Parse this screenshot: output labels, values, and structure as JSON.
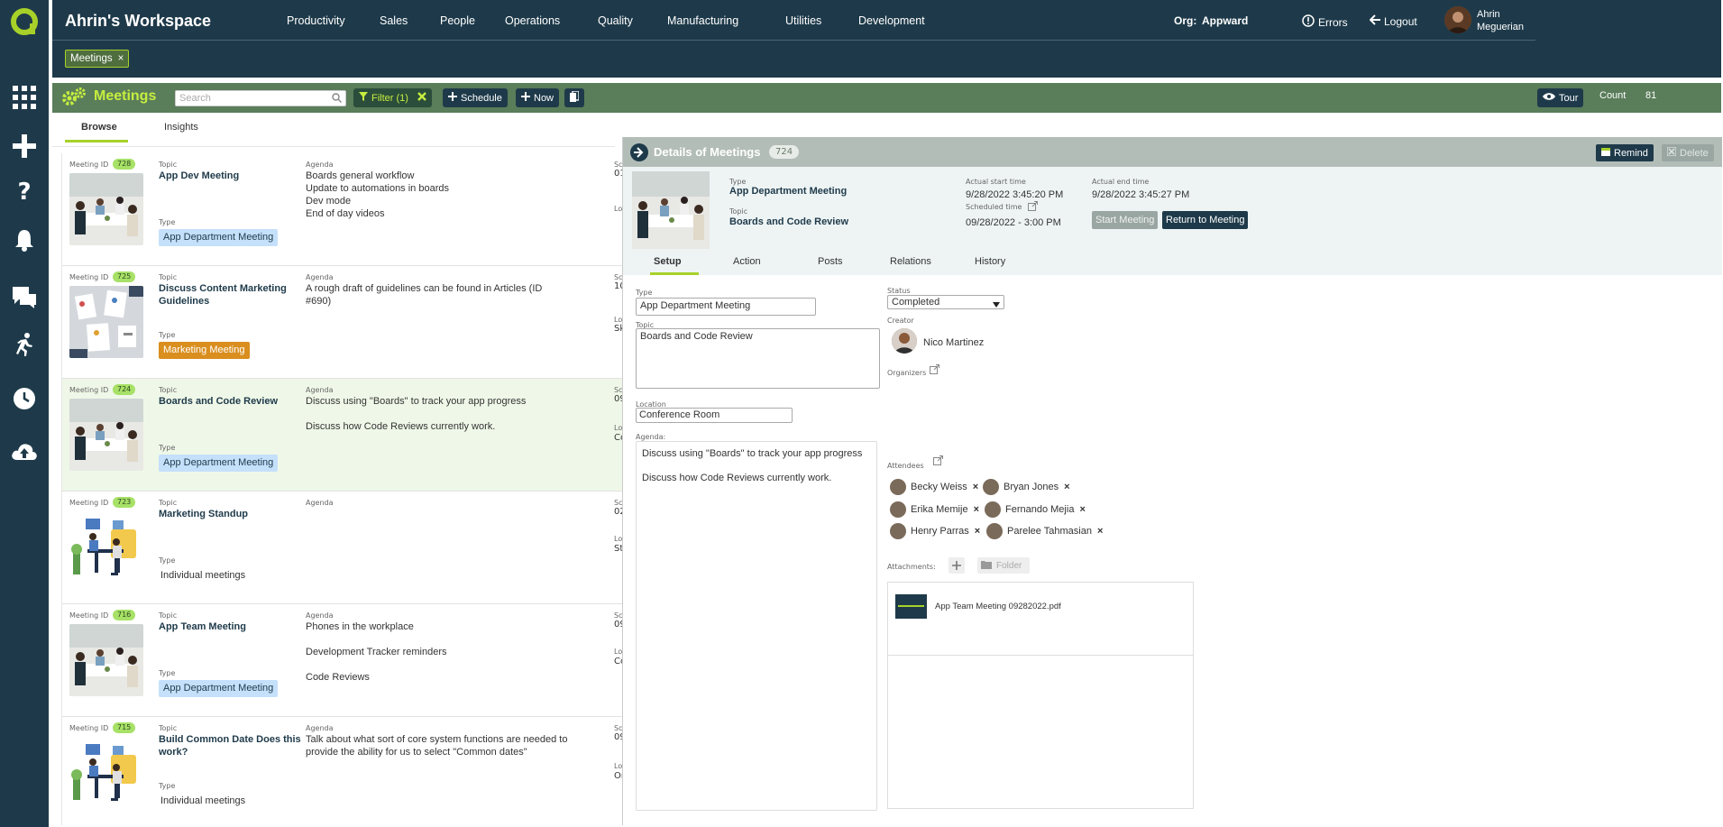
{
  "workspace": {
    "title": "Ahrin's Workspace"
  },
  "topnav": [
    "Productivity",
    "Sales",
    "People",
    "Operations",
    "Quality",
    "Manufacturing",
    "Utilities",
    "Development"
  ],
  "org": {
    "label": "Org:",
    "value": "Appward"
  },
  "header_actions": {
    "errors": "Errors",
    "logout": "Logout"
  },
  "user": {
    "first": "Ahrin",
    "last": "Meguerian"
  },
  "open_tab": {
    "label": "Meetings",
    "close": "×"
  },
  "toolbar": {
    "title": "Meetings",
    "search_placeholder": "Search",
    "filter": "Filter (1)",
    "schedule": "Schedule",
    "now": "Now",
    "tour": "Tour",
    "count_label": "Count",
    "count_value": "81"
  },
  "subtabs": {
    "browse": "Browse",
    "insights": "Insights"
  },
  "list_labels": {
    "meeting_id": "Meeting ID",
    "topic": "Topic",
    "type": "Type",
    "agenda": "Agenda"
  },
  "meetings": [
    {
      "id": "728",
      "topic": "App Dev Meeting",
      "type": "App Department Meeting",
      "agenda": [
        "Boards general workflow",
        "Update to automations in boards",
        "Dev mode",
        "End of day videos"
      ],
      "edge_a": "Sc",
      "edge_b": "01",
      "edge_c": "Lo"
    },
    {
      "id": "725",
      "topic": "Discuss Content Marketing Guidelines",
      "type": "Marketing Meeting",
      "agenda": [
        "A rough draft of guidelines can be found in Articles (ID #690)"
      ],
      "edge_a": "Sc",
      "edge_b": "10",
      "edge_c": "Lo",
      "edge_d": "Sk"
    },
    {
      "id": "724",
      "topic": "Boards and Code Review",
      "type": "App Department Meeting",
      "agenda": [
        "Discuss using \"Boards\" to track your app progress",
        "",
        "Discuss how Code Reviews currently work."
      ],
      "edge_a": "Sc",
      "edge_b": "09",
      "edge_c": "Lo",
      "edge_d": "Co"
    },
    {
      "id": "723",
      "topic": "Marketing Standup",
      "type": "Individual meetings",
      "agenda": [],
      "edge_a": "Sc",
      "edge_b": "02",
      "edge_c": "Lo",
      "edge_d": "St"
    },
    {
      "id": "716",
      "topic": "App Team Meeting",
      "type": "App Department Meeting",
      "agenda": [
        "Phones in the workplace",
        "",
        "Development Tracker reminders",
        "",
        "Code Reviews"
      ],
      "edge_a": "Sc",
      "edge_b": "09",
      "edge_c": "Lo",
      "edge_d": "Co"
    },
    {
      "id": "715",
      "topic": "Build Common Date Does this work?",
      "type": "Individual meetings",
      "agenda": [
        "Talk about what sort of core system functions are needed to provide the ability for us to select \"Common dates\""
      ],
      "edge_a": "Sc",
      "edge_b": "09",
      "edge_c": "Lo",
      "edge_d": "Or"
    }
  ],
  "details": {
    "title": "Details of Meetings",
    "id": "724",
    "remind": "Remind",
    "delete": "Delete",
    "type_label": "Type",
    "type": "App Department Meeting",
    "topic_label": "Topic",
    "topic": "Boards and Code Review",
    "actual_start_label": "Actual start time",
    "actual_start": "9/28/2022 3:45:20 PM",
    "actual_end_label": "Actual end time",
    "actual_end": "9/28/2022 3:45:27 PM",
    "scheduled_label": "Scheduled time",
    "scheduled": "09/28/2022 - 3:00 PM",
    "start_btn": "Start Meeting",
    "return_btn": "Return to Meeting",
    "tabs": [
      "Setup",
      "Action",
      "Posts",
      "Relations",
      "History"
    ],
    "form": {
      "type_label": "Type",
      "type": "App Department Meeting",
      "status_label": "Status",
      "status": "Completed",
      "topic_label": "Topic",
      "topic": "Boards and Code Review",
      "creator_label": "Creator",
      "creator": "Nico Martinez",
      "organizers_label": "Organizers",
      "location_label": "Location",
      "location": "Conference Room",
      "agenda_label": "Agenda:",
      "agenda_1": "Discuss using \"Boards\" to track your app progress",
      "agenda_2": "Discuss how Code Reviews currently work.",
      "attendees_label": "Attendees",
      "attendees": [
        "Becky Weiss",
        "Bryan Jones",
        "Erika Memije",
        "Fernando Mejia",
        "Henry Parras",
        "Parelee Tahmasian"
      ],
      "attachments_label": "Attachments:",
      "folder": "Folder",
      "file": "App Team Meeting 09282022.pdf"
    }
  },
  "colors": {
    "nav": "#1e3a4a",
    "accent": "#a7d129",
    "toolbar": "#5a7d5a"
  }
}
